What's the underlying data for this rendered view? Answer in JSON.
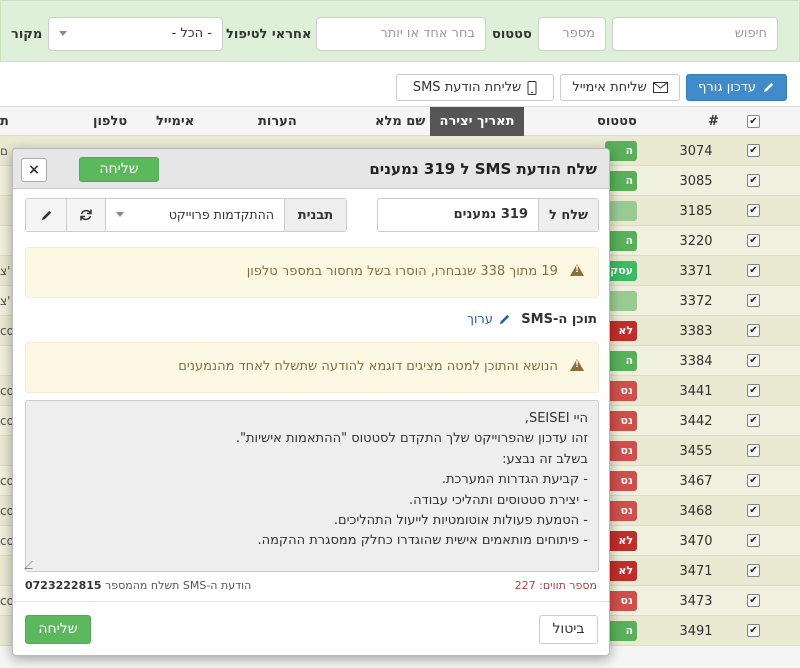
{
  "filters": {
    "search_placeholder": "חיפוש",
    "number_placeholder": "מספר",
    "status_label": "סטטוס",
    "status_placeholder": "בחר אחד או יותר",
    "handler_label": "אחראי לטיפול",
    "handler_value": "- הכל -",
    "source_label": "מקור"
  },
  "toolbar": {
    "update_contact": "עדכון גורף",
    "send_email": "שליחת אימייל",
    "send_sms": "שליחת הודעת SMS"
  },
  "table": {
    "headers": {
      "hash": "#",
      "status": "סטטוס",
      "created": "תאריך יצירה",
      "full_name": "שם מלא",
      "notes": "הערות",
      "email": "אימייל",
      "phone": "טלפון",
      "edge": "ת"
    },
    "rows": [
      {
        "id": "3074",
        "badge": "ה",
        "color": "#5cb85c",
        "edge": "ם"
      },
      {
        "id": "3085",
        "badge": "ה",
        "color": "#5cb85c",
        "edge": ""
      },
      {
        "id": "3185",
        "badge": "",
        "color": "#9fd49a",
        "edge": ""
      },
      {
        "id": "3220",
        "badge": "ה",
        "color": "#5cb85c",
        "edge": ""
      },
      {
        "id": "3371",
        "badge": "עסק",
        "color": "#3cc46a",
        "edge": "צ'"
      },
      {
        "id": "3372",
        "badge": "",
        "color": "#9fd49a",
        "edge": "צ'"
      },
      {
        "id": "3383",
        "badge": "לא",
        "color": "#c9302c",
        "edge": "co"
      },
      {
        "id": "3384",
        "badge": "ה",
        "color": "#5cb85c",
        "edge": ""
      },
      {
        "id": "3441",
        "badge": "נס",
        "color": "#d9534f",
        "edge": "co"
      },
      {
        "id": "3442",
        "badge": "נס",
        "color": "#d9534f",
        "edge": "co"
      },
      {
        "id": "3455",
        "badge": "נס",
        "color": "#d9534f",
        "edge": ""
      },
      {
        "id": "3467",
        "badge": "נס",
        "color": "#d9534f",
        "edge": "co"
      },
      {
        "id": "3468",
        "badge": "נס",
        "color": "#d9534f",
        "edge": "co"
      },
      {
        "id": "3470",
        "badge": "לא",
        "color": "#c9302c",
        "edge": "co"
      },
      {
        "id": "3471",
        "badge": "לא",
        "color": "#c9302c",
        "edge": ""
      },
      {
        "id": "3473",
        "badge": "נס",
        "color": "#d9534f",
        "edge": "co"
      },
      {
        "id": "3491",
        "badge": "ה",
        "color": "#5cb85c",
        "edge": ""
      }
    ]
  },
  "modal": {
    "title": "שלח הודעת SMS ל 319 נמענים",
    "send": "שליחה",
    "close": "×",
    "send_to_label": "שלח ל",
    "send_to_value": "319 נמענים",
    "template_label": "תבנית",
    "template_value": "ההתקדמות פרוייקט",
    "alert_missing": "19 מתוך 338 שנבחרו, הוסרו בשל מחסור במספר טלפון",
    "content_label": "תוכן ה-SMS",
    "edit_link": "ערוך",
    "alert_sample": "הנושא והתוכן למטה מציגים דוגמא להודעה שתשלח לאחד מהנמענים",
    "sms_lines": [
      "היי SEISEI,",
      "זהו עדכון שהפרוייקט שלך התקדם לסטטוס \"ההתאמות אישיות\".",
      "בשלב זה נבצע:",
      "- קביעת הגדרות המערכת.",
      "- יצירת סטטוסים ותהליכי עבודה.",
      "- הטמעת פעולות אוטומטיות לייעול התהליכים.",
      "- פיתוחים מותאמים אישית שהוגדרו כחלק ממסגרת ההקמה."
    ],
    "char_count_label": "מספר תווים:",
    "char_count": "227",
    "sender_info": "הודעת ה-SMS תשלח מהמספר",
    "sender_number": "0723222815",
    "cancel": "ביטול",
    "footer_send": "שליחה"
  },
  "colors": {
    "green": "#5cb85c",
    "blue": "#428bca",
    "warning_bg": "#fcf8e3",
    "warning_text": "#8a6d3b"
  }
}
